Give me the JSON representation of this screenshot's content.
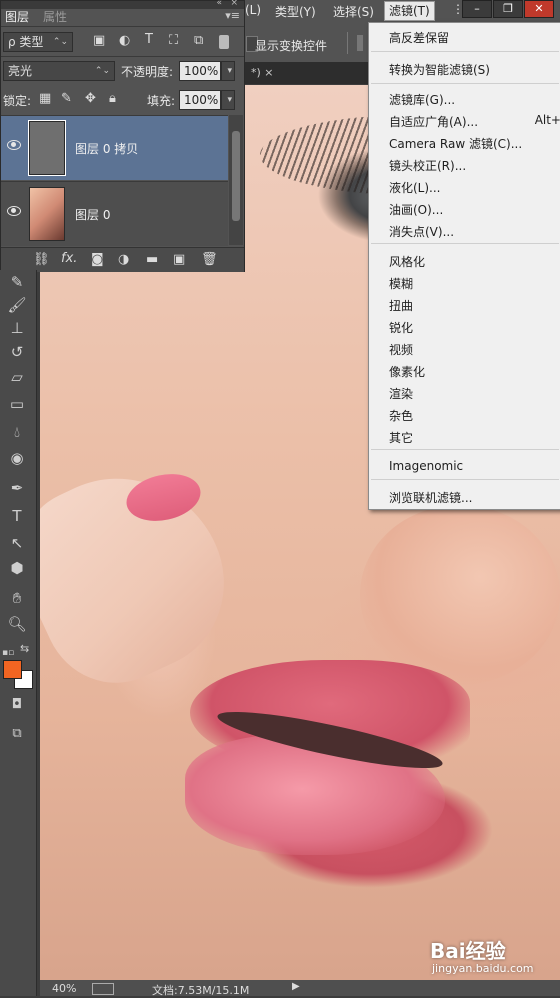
{
  "menubar": {
    "items": [
      {
        "label": "(L)"
      },
      {
        "label": "类型(Y)"
      },
      {
        "label": "选择(S)"
      },
      {
        "label": "滤镜(T)"
      }
    ],
    "window_buttons": [
      "–",
      "❐",
      "✕"
    ]
  },
  "optbar": {
    "show_transform": "显示变换控件"
  },
  "doc_tab": {
    "label": "*) ×"
  },
  "layers_panel": {
    "tabs": [
      "图层",
      "属性"
    ],
    "kind_label": "ρ 类型",
    "blend_mode": "亮光",
    "opacity_label": "不透明度:",
    "opacity_value": "100%",
    "lock_label": "锁定:",
    "fill_label": "填充:",
    "fill_value": "100%",
    "layers": [
      {
        "name": "图层 0 拷贝",
        "selected": true
      },
      {
        "name": "图层 0",
        "selected": false
      }
    ],
    "footer_icons": [
      "link-icon",
      "fx-icon",
      "mask-icon",
      "adjustment-icon",
      "folder-icon",
      "new-layer-icon",
      "trash-icon"
    ],
    "fx_label": "fx."
  },
  "filter_menu": {
    "items": [
      {
        "label": "高反差保留",
        "shortcut": ""
      },
      {
        "label": "转换为智能滤镜(S)",
        "shortcut": ""
      },
      {
        "label": "滤镜库(G)...",
        "shortcut": ""
      },
      {
        "label": "自适应广角(A)...",
        "shortcut": "Alt+"
      },
      {
        "label": "Camera Raw 滤镜(C)...",
        "shortcut": ""
      },
      {
        "label": "镜头校正(R)...",
        "shortcut": ""
      },
      {
        "label": "液化(L)...",
        "shortcut": ""
      },
      {
        "label": "油画(O)...",
        "shortcut": ""
      },
      {
        "label": "消失点(V)...",
        "shortcut": ""
      },
      {
        "label": "风格化",
        "shortcut": ""
      },
      {
        "label": "模糊",
        "shortcut": ""
      },
      {
        "label": "扭曲",
        "shortcut": ""
      },
      {
        "label": "锐化",
        "shortcut": ""
      },
      {
        "label": "视频",
        "shortcut": ""
      },
      {
        "label": "像素化",
        "shortcut": ""
      },
      {
        "label": "渲染",
        "shortcut": ""
      },
      {
        "label": "杂色",
        "shortcut": ""
      },
      {
        "label": "其它",
        "shortcut": ""
      },
      {
        "label": "Imagenomic",
        "shortcut": ""
      },
      {
        "label": "浏览联机滤镜...",
        "shortcut": ""
      }
    ]
  },
  "status": {
    "zoom": "40%",
    "doc": "文档:7.53M/15.1M"
  },
  "watermark": {
    "brand": "Bai经验",
    "url": "jingyan.baidu.com"
  },
  "colors": {
    "foreground": "#f26522",
    "background": "#ffffff",
    "selected_layer": "#5c7394"
  }
}
